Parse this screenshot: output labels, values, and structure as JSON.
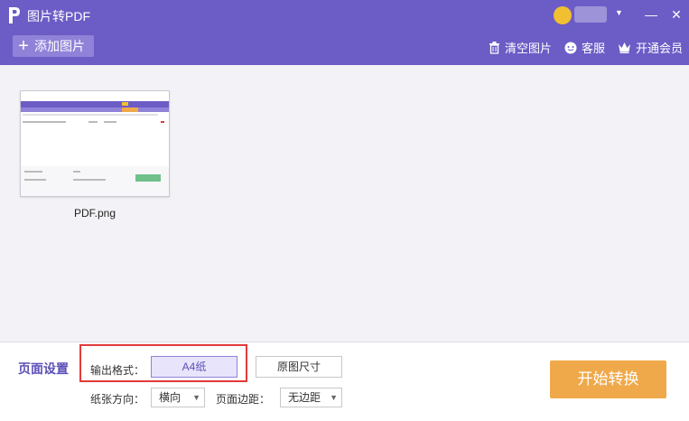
{
  "titlebar": {
    "title": "图片转PDF",
    "minimize": "—",
    "close": "✕"
  },
  "toolbar": {
    "add_label": "添加图片",
    "add_icon": "+",
    "clear_label": "清空图片",
    "service_label": "客服",
    "vip_label": "开通会员"
  },
  "files": [
    {
      "name": "PDF.png"
    }
  ],
  "settings": {
    "section_label": "页面设置",
    "format_label": "输出格式：",
    "format_a4": "A4纸",
    "format_original": "原图尺寸",
    "orientation_label": "纸张方向：",
    "orientation_value": "横向",
    "margin_label": "页面边距：",
    "margin_value": "无边距",
    "start_label": "开始转换"
  },
  "colors": {
    "accent": "#6c5cc6",
    "start_button": "#f0a94a",
    "highlight": "#e23a3a"
  }
}
